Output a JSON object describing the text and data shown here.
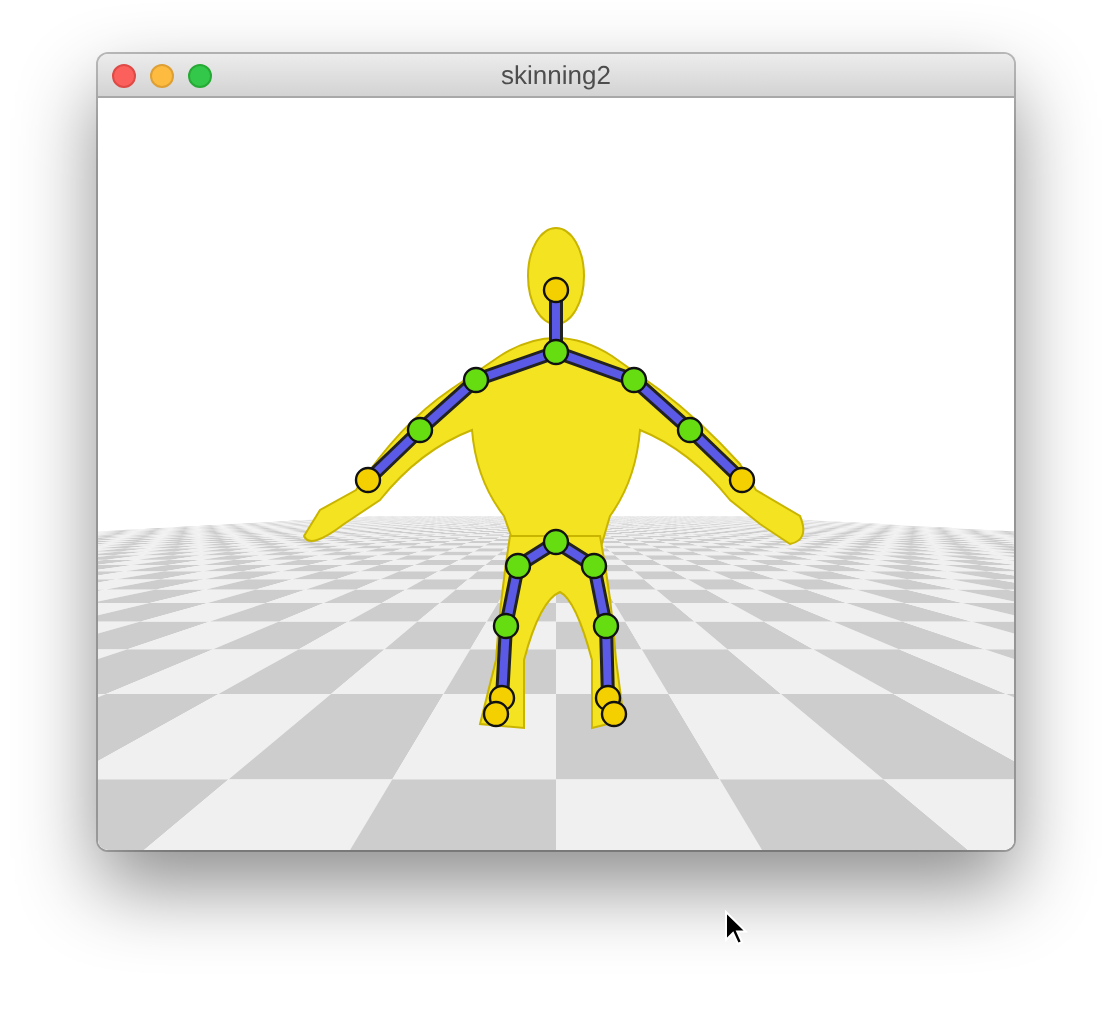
{
  "window": {
    "title": "skinning2"
  }
}
